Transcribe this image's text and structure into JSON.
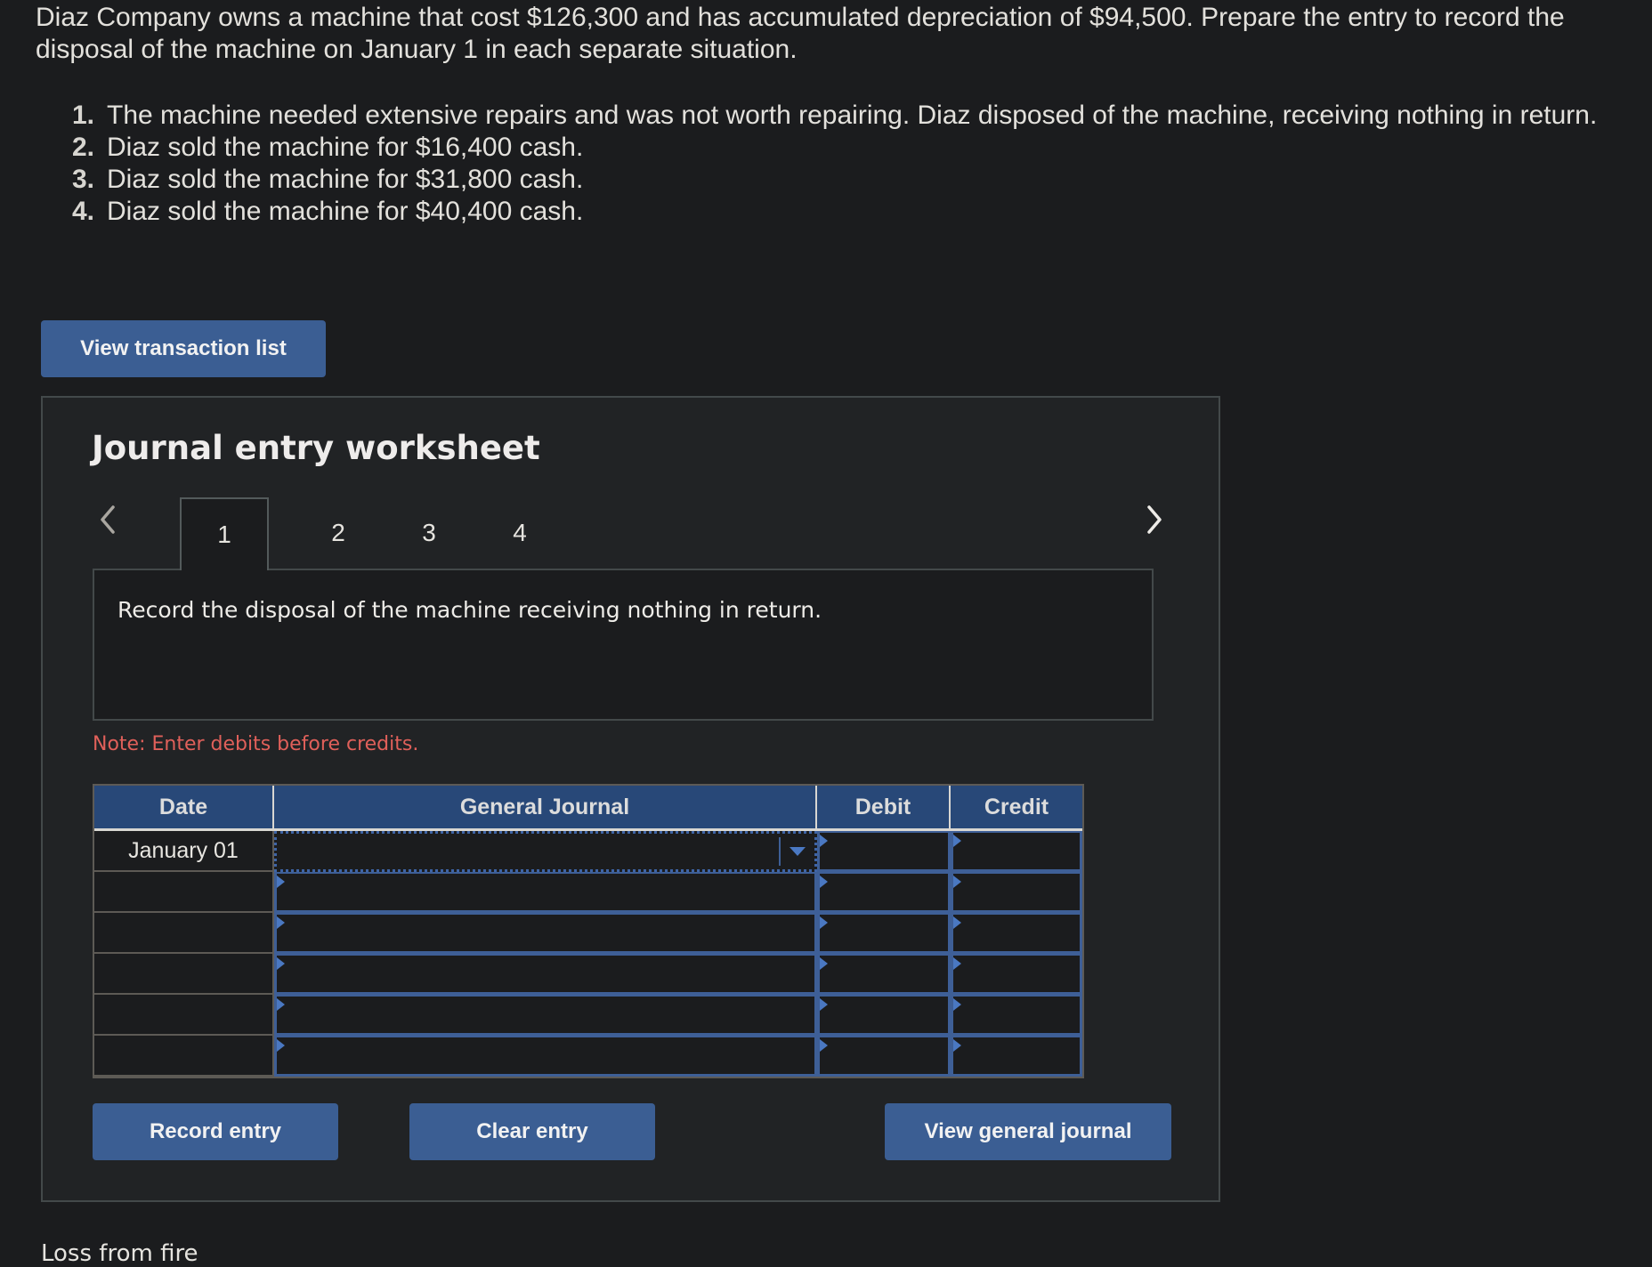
{
  "problem": {
    "intro": "Diaz Company owns a machine that cost $126,300 and has accumulated depreciation of $94,500. Prepare the entry to record the disposal of the machine on January 1 in each separate situation.",
    "steps": [
      {
        "num": "1.",
        "text": "The machine needed extensive repairs and was not worth repairing. Diaz disposed of the machine, receiving nothing in return."
      },
      {
        "num": "2.",
        "text": "Diaz sold the machine for $16,400 cash."
      },
      {
        "num": "3.",
        "text": "Diaz sold the machine for $31,800 cash."
      },
      {
        "num": "4.",
        "text": "Diaz sold the machine for $40,400 cash."
      }
    ]
  },
  "buttons": {
    "view_transaction_list": "View transaction list",
    "record_entry": "Record entry",
    "clear_entry": "Clear entry",
    "view_general_journal": "View general journal"
  },
  "worksheet": {
    "title": "Journal entry worksheet",
    "prev_icon": "chevron-left-icon",
    "next_icon": "chevron-right-icon",
    "tabs": [
      {
        "label": "1",
        "active": true
      },
      {
        "label": "2",
        "active": false
      },
      {
        "label": "3",
        "active": false
      },
      {
        "label": "4",
        "active": false
      }
    ],
    "description": "Record the disposal of the machine receiving nothing in return.",
    "note": "Note: Enter debits before credits."
  },
  "journal_table": {
    "headers": {
      "date": "Date",
      "general_journal": "General Journal",
      "debit": "Debit",
      "credit": "Credit"
    },
    "rows": [
      {
        "date": "January 01",
        "account": "",
        "debit": "",
        "credit": ""
      },
      {
        "date": "",
        "account": "",
        "debit": "",
        "credit": ""
      },
      {
        "date": "",
        "account": "",
        "debit": "",
        "credit": ""
      },
      {
        "date": "",
        "account": "",
        "debit": "",
        "credit": ""
      },
      {
        "date": "",
        "account": "",
        "debit": "",
        "credit": ""
      },
      {
        "date": "",
        "account": "",
        "debit": "",
        "credit": ""
      }
    ]
  },
  "footer": {
    "text": "Loss from fire"
  },
  "colors": {
    "accent": "#3b5e93",
    "header_bg": "#284878",
    "note": "#e0605a",
    "background": "#1b1c1e"
  }
}
